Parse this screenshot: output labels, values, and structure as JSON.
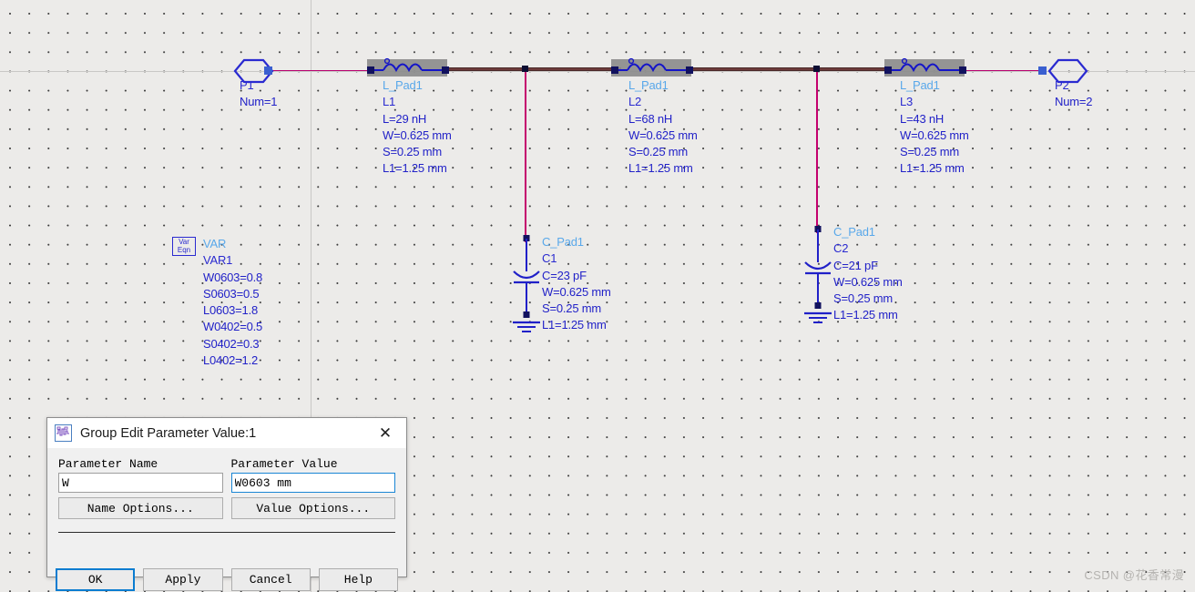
{
  "schematic": {
    "ports": [
      {
        "name": "P1",
        "num": "Num=1"
      },
      {
        "name": "P2",
        "num": "Num=2"
      }
    ],
    "inductors": [
      {
        "type": "L_Pad1",
        "name": "L1",
        "L": "L=29 nH",
        "W": "W=0.625 mm",
        "S": "S=0.25 mm",
        "L1": "L1=1.25 mm"
      },
      {
        "type": "L_Pad1",
        "name": "L2",
        "L": "L=68 nH",
        "W": "W=0.625 mm",
        "S": "S=0.25 mm",
        "L1": "L1=1.25 mm"
      },
      {
        "type": "L_Pad1",
        "name": "L3",
        "L": "L=43 nH",
        "W": "W=0.625 mm",
        "S": "S=0.25 mm",
        "L1": "L1=1.25 mm"
      }
    ],
    "capacitors": [
      {
        "type": "C_Pad1",
        "name": "C1",
        "C": "C=23 pF",
        "W": "W=0.625 mm",
        "S": "S=0.25 mm",
        "L1": "L1=1.25 mm"
      },
      {
        "type": "C_Pad1",
        "name": "C2",
        "C": "C=21 pF",
        "W": "W=0.625 mm",
        "S": "S=0.25 mm",
        "L1": "L1=1.25 mm"
      }
    ],
    "var_block": {
      "icon_line1": "Var",
      "icon_line2": "Eqn",
      "type": "VAR",
      "name": "VAR1",
      "equations": [
        "W0603=0.8",
        "S0603=0.5",
        "L0603=1.8",
        "W0402=0.5",
        "S0402=0.3",
        "L0402=1.2"
      ]
    },
    "colors": {
      "component_type": "#59a8ea",
      "component_label": "#2a2ad0",
      "wire": "#c4006e",
      "wire_selected": "#6e3b3b",
      "canvas": "#ecebe9"
    }
  },
  "dialog": {
    "title": "Group Edit Parameter Value:1",
    "close_label": "✕",
    "icon_name": "schematic-waveform-icon",
    "name_field": {
      "label": "Parameter Name",
      "value": "W",
      "placeholder": ""
    },
    "value_field": {
      "label": "Parameter Value",
      "value": "W0603 mm",
      "placeholder": ""
    },
    "name_options_label": "Name Options...",
    "value_options_label": "Value Options...",
    "buttons": [
      {
        "label": "OK",
        "default": true
      },
      {
        "label": "Apply",
        "default": false
      },
      {
        "label": "Cancel",
        "default": false
      },
      {
        "label": "Help",
        "default": false
      }
    ]
  },
  "watermark": {
    "text": "CSDN @花香常漫"
  }
}
